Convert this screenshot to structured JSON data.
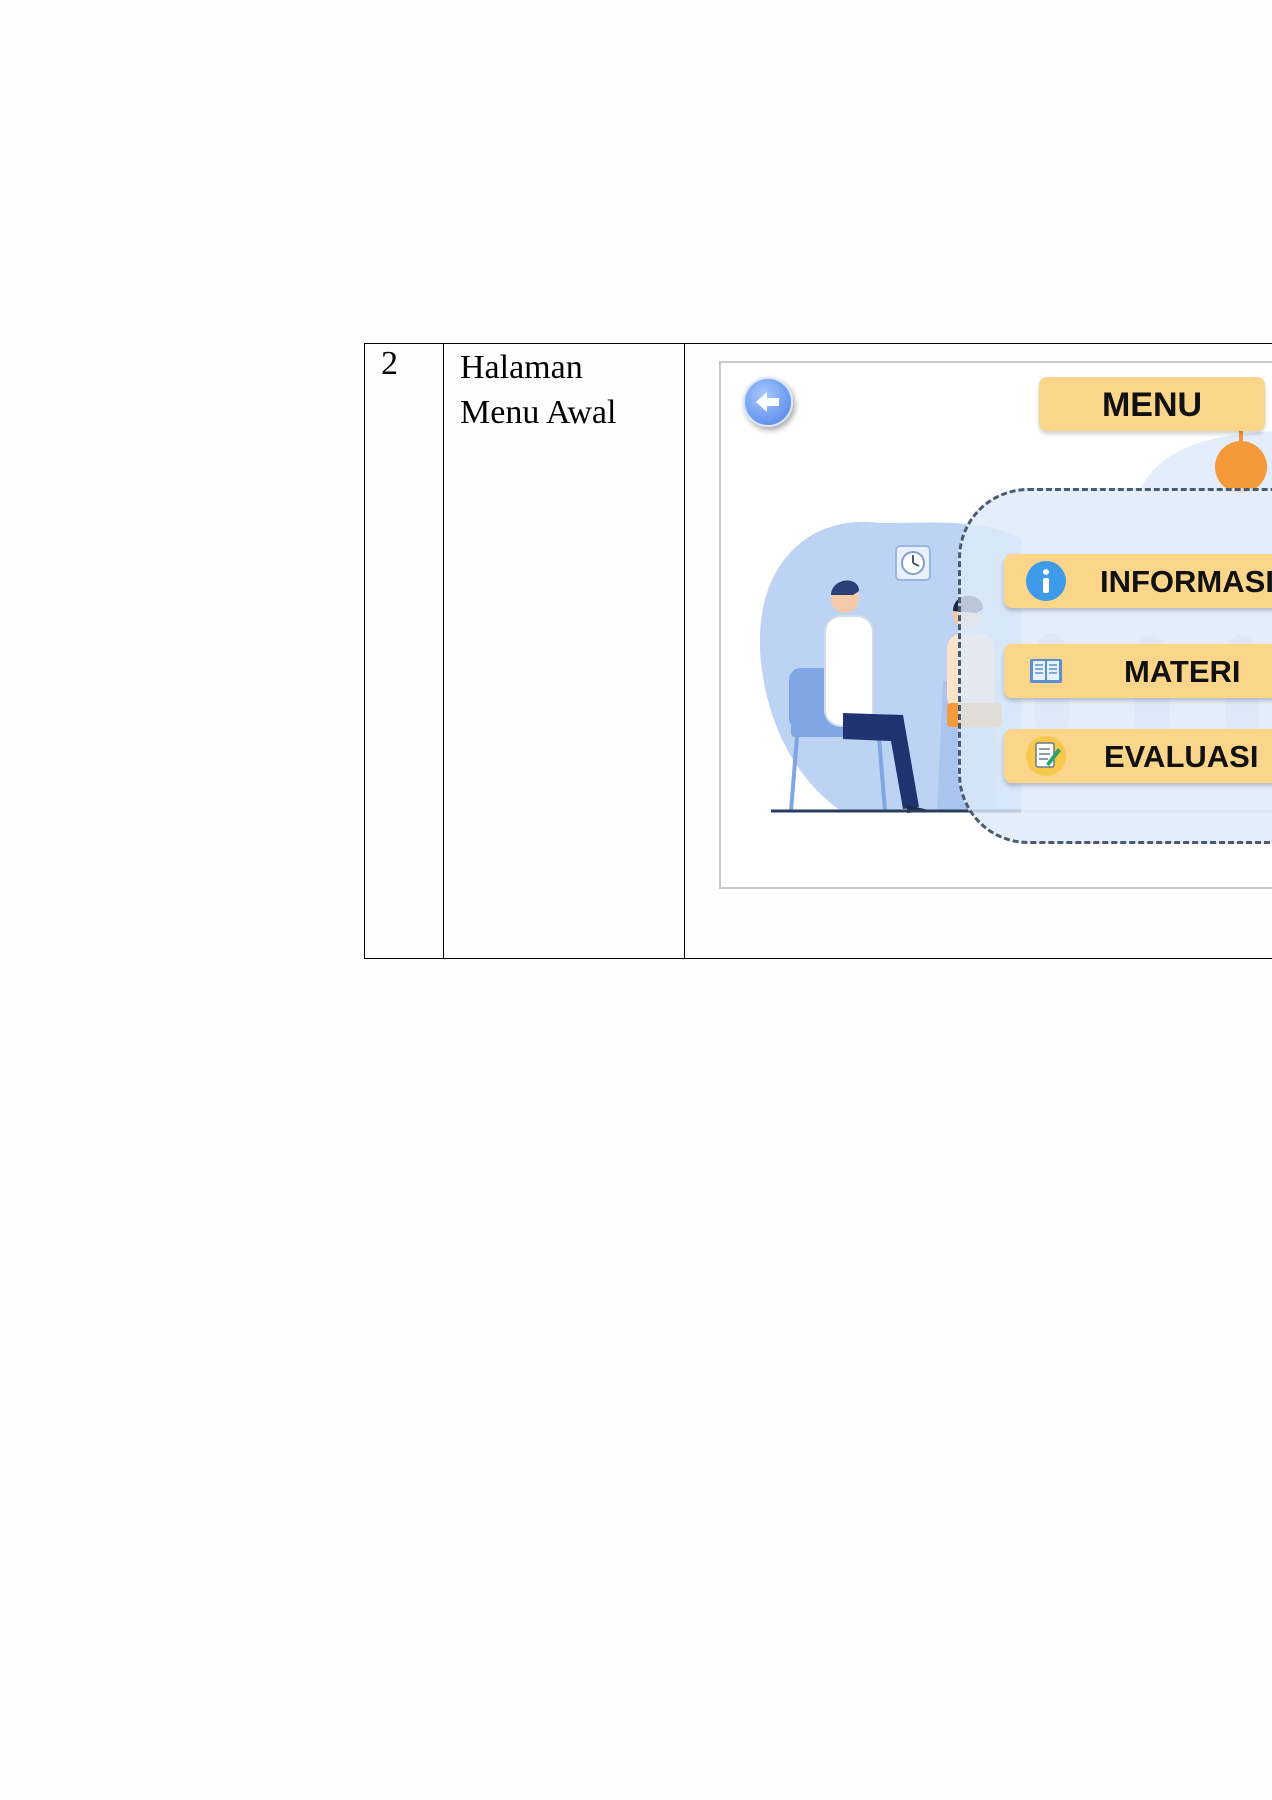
{
  "table": {
    "row_number": "2",
    "page_name": "Halaman Menu Awal"
  },
  "screen": {
    "back_icon": "arrow-left-circle-icon",
    "menu_title": "MENU",
    "buttons": [
      {
        "label": "INFORMASI",
        "icon": "info-icon"
      },
      {
        "label": "MATERI",
        "icon": "book-icon"
      },
      {
        "label": "EVALUASI",
        "icon": "checklist-icon"
      }
    ],
    "colors": {
      "button_fill": "#fbd58a",
      "panel_fill": "#deeafa",
      "illustration_blue": "#bcd3f4",
      "back_button": "#6f9cf0"
    }
  }
}
